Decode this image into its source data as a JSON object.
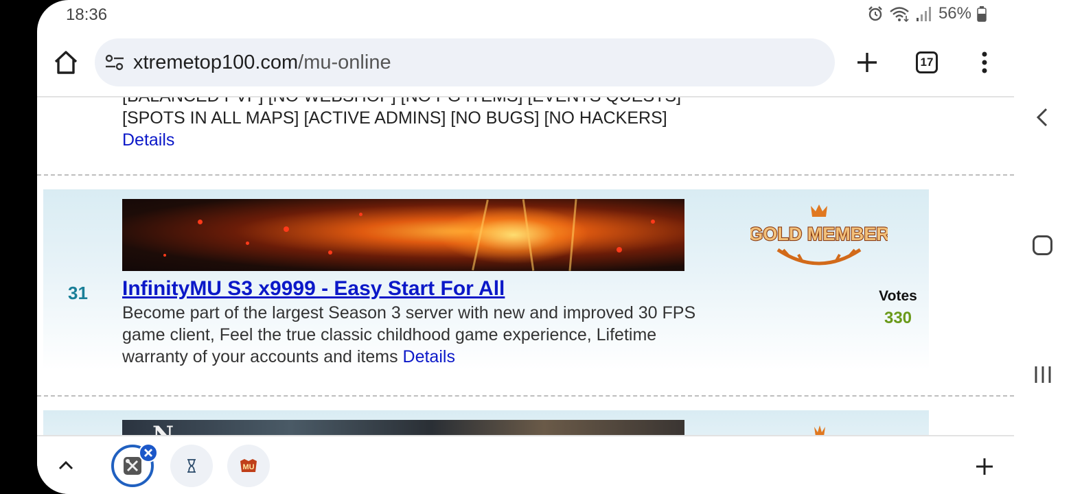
{
  "status_bar": {
    "time": "18:36",
    "battery": "56%",
    "icons": [
      "alarm-icon",
      "wifi-icon",
      "signal-icon",
      "battery-icon"
    ]
  },
  "browser": {
    "url_host": "xtremetop100.com",
    "url_path": "/mu-online",
    "tab_count": "17"
  },
  "listing_prev": {
    "clipped_line": "[BALANCED PVP] [NO WEBSHOP] [NO PG ITEMS] [EVENTS QUESTS]",
    "text_line": "[SPOTS IN ALL MAPS] [ACTIVE ADMINS] [NO BUGS] [NO HACKERS]",
    "details_link": "Details"
  },
  "listing": {
    "rank": "31",
    "title": "InfinityMU S3 x9999 - Easy Start For All",
    "description": "Become part of the largest Season 3 server with new and improved 30 FPS game client, Feel the true classic childhood game experience, Lifetime warranty of your accounts and items",
    "details_link": "Details",
    "badge_text": "GOLD MEMBER",
    "votes_label": "Votes",
    "votes_value": "330"
  },
  "listing_next": {
    "banner_text": "N"
  },
  "tab_strip": {
    "tabs": [
      {
        "icon": "tools-favicon",
        "active": true
      },
      {
        "icon": "hourglass-favicon",
        "active": false
      },
      {
        "icon": "mu-favicon",
        "active": false
      }
    ],
    "mu_favicon_text": "MU"
  },
  "colors": {
    "link": "#0b18c8",
    "rank": "#1a7f98",
    "votes": "#6a9a1a",
    "accent": "#1b57c9"
  }
}
